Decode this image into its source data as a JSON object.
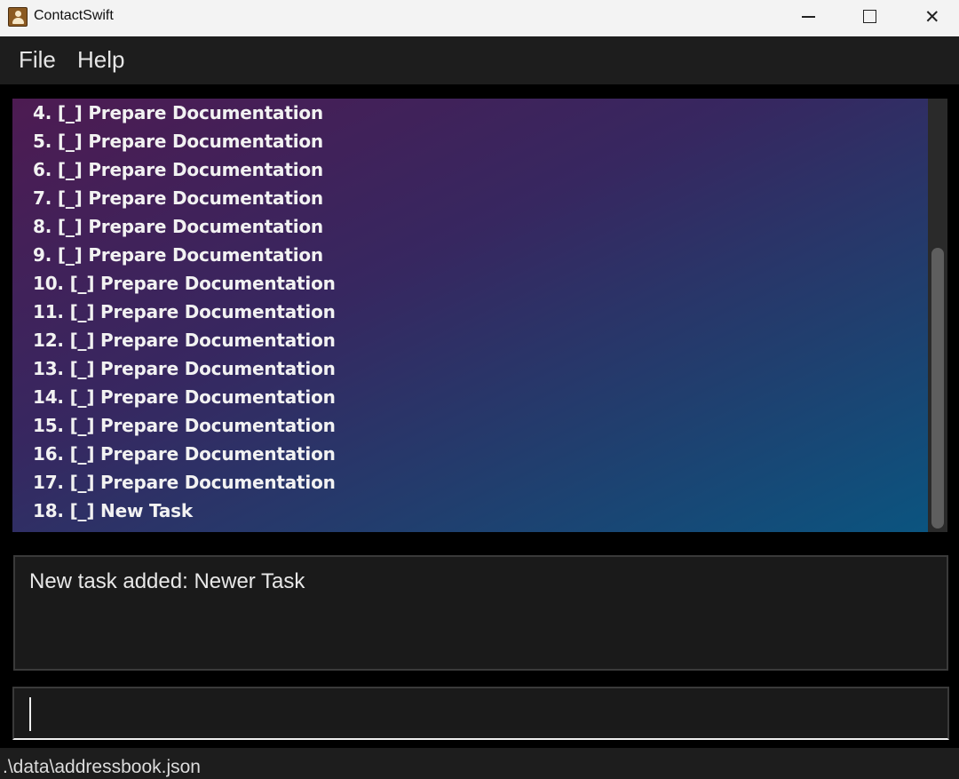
{
  "window": {
    "title": "ContactSwift",
    "icon": "contact-book-icon",
    "minimize_glyph": "",
    "maximize_glyph": "",
    "close_glyph": "✕"
  },
  "menu": {
    "items": [
      "File",
      "Help"
    ]
  },
  "task_list": {
    "items": [
      "4. [_] Prepare Documentation",
      "5. [_] Prepare Documentation",
      "6. [_] Prepare Documentation",
      "7. [_] Prepare Documentation",
      "8. [_] Prepare Documentation",
      "9. [_] Prepare Documentation",
      "10. [_] Prepare Documentation",
      "11. [_] Prepare Documentation",
      "12. [_] Prepare Documentation",
      "13. [_] Prepare Documentation",
      "14. [_] Prepare Documentation",
      "15. [_] Prepare Documentation",
      "16. [_] Prepare Documentation",
      "17. [_] Prepare Documentation",
      "18. [_] New Task"
    ]
  },
  "result": {
    "message": "New task added: Newer Task"
  },
  "command": {
    "value": "",
    "placeholder": ""
  },
  "status": {
    "file_path": ".\\data\\addressbook.json"
  },
  "colors": {
    "gradient_start": "#4d1b52",
    "gradient_end": "#0a5580",
    "background": "#000000",
    "panel": "#1a1a1a"
  }
}
